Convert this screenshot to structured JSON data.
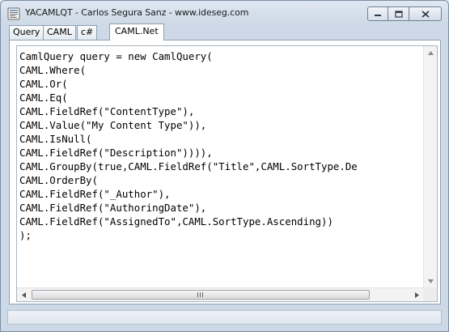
{
  "window": {
    "title": "YACAMLQT - Carlos Segura Sanz - www.ideseg.com",
    "controls": [
      "minimize-icon",
      "maximize-icon",
      "close-icon"
    ]
  },
  "tabs": [
    {
      "label": "Query",
      "active": false
    },
    {
      "label": "CAML",
      "active": false
    },
    {
      "label": "c#",
      "active": false
    },
    {
      "label": "CAML.Net",
      "active": true
    }
  ],
  "editor": {
    "lines": [
      "CamlQuery query = new CamlQuery(",
      "CAML.Where(",
      "CAML.Or(",
      "CAML.Eq(",
      "CAML.FieldRef(\"ContentType\"),",
      "CAML.Value(\"My Content Type\")),",
      "CAML.IsNull(",
      "CAML.FieldRef(\"Description\")))),",
      "CAML.GroupBy(true,CAML.FieldRef(\"Title\",CAML.SortType.De",
      "CAML.OrderBy(",
      "CAML.FieldRef(\"_Author\"),",
      "CAML.FieldRef(\"AuthoringDate\"),",
      "CAML.FieldRef(\"AssignedTo\",CAML.SortType.Ascending))",
      ");"
    ]
  },
  "colors": {
    "titlebar": "#cdd9e6",
    "close_button": "#d2dbe6",
    "editor_background": "#ffffff"
  }
}
